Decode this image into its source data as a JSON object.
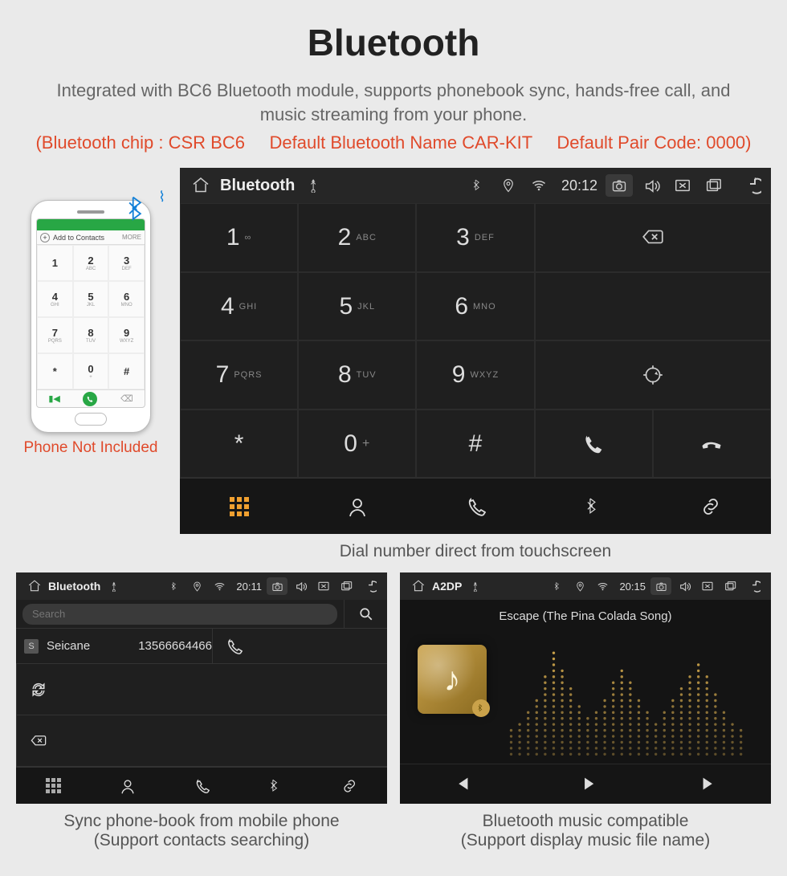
{
  "page": {
    "title": "Bluetooth",
    "subtitle": "Integrated with BC6 Bluetooth module, supports phonebook sync, hands-free call, and music streaming from your phone.",
    "specs": "(Bluetooth chip : CSR BC6     Default Bluetooth Name CAR-KIT     Default Pair Code: 0000)"
  },
  "phone_mock": {
    "add_contacts_label": "Add to Contacts",
    "more_label": "MORE",
    "keys": [
      {
        "n": "1",
        "l": ""
      },
      {
        "n": "2",
        "l": "ABC"
      },
      {
        "n": "3",
        "l": "DEF"
      },
      {
        "n": "4",
        "l": "GHI"
      },
      {
        "n": "5",
        "l": "JKL"
      },
      {
        "n": "6",
        "l": "MNO"
      },
      {
        "n": "7",
        "l": "PQRS"
      },
      {
        "n": "8",
        "l": "TUV"
      },
      {
        "n": "9",
        "l": "WXYZ"
      },
      {
        "n": "*",
        "l": ""
      },
      {
        "n": "0",
        "l": "+"
      },
      {
        "n": "#",
        "l": ""
      }
    ],
    "caption": "Phone Not Included"
  },
  "dialer_unit": {
    "statusbar": {
      "title": "Bluetooth",
      "time": "20:12"
    },
    "keys": [
      {
        "n": "1",
        "l": "∞"
      },
      {
        "n": "2",
        "l": "ABC"
      },
      {
        "n": "3",
        "l": "DEF"
      },
      {
        "n": "4",
        "l": "GHI"
      },
      {
        "n": "5",
        "l": "JKL"
      },
      {
        "n": "6",
        "l": "MNO"
      },
      {
        "n": "7",
        "l": "PQRS"
      },
      {
        "n": "8",
        "l": "TUV"
      },
      {
        "n": "9",
        "l": "WXYZ"
      },
      {
        "n": "*",
        "l": ""
      },
      {
        "n": "0",
        "l": "+"
      },
      {
        "n": "#",
        "l": ""
      }
    ],
    "caption": "Dial number direct from touchscreen"
  },
  "phonebook_unit": {
    "statusbar": {
      "title": "Bluetooth",
      "time": "20:11"
    },
    "search_placeholder": "Search",
    "contact": {
      "tag": "S",
      "name": "Seicane",
      "number": "13566664466"
    },
    "caption_line1": "Sync phone-book from mobile phone",
    "caption_line2": "(Support contacts searching)"
  },
  "a2dp_unit": {
    "statusbar": {
      "title": "A2DP",
      "time": "20:15"
    },
    "track_title": "Escape (The Pina Colada Song)",
    "caption_line1": "Bluetooth music compatible",
    "caption_line2": "(Support display music file name)"
  }
}
